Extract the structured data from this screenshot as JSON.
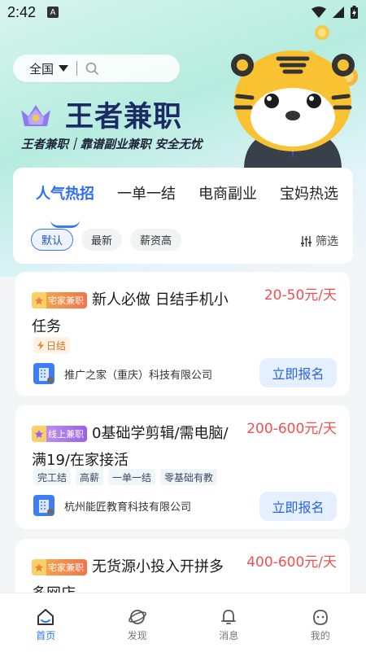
{
  "status_bar": {
    "time": "2:42",
    "badge": "A"
  },
  "search": {
    "city": "全国"
  },
  "app": {
    "title": "王者兼职",
    "slogan": "王者兼职｜靠谱副业兼职 安全无忧"
  },
  "tabs": [
    {
      "label": "人气热招",
      "active": true
    },
    {
      "label": "一单一结"
    },
    {
      "label": "电商副业"
    },
    {
      "label": "宝妈热选"
    }
  ],
  "sort_chips": [
    {
      "label": "默认",
      "active": true
    },
    {
      "label": "最新"
    },
    {
      "label": "薪资高"
    }
  ],
  "filter_label": "筛选",
  "jobs": [
    {
      "badge": "宅家兼职",
      "title": "新人必做 日结手机小任务",
      "salary": "20-50元/天",
      "tags": [
        "日结"
      ],
      "company": "推广之家（重庆）科技有限公司",
      "apply": "立即报名"
    },
    {
      "badge": "线上兼职",
      "title": "0基础学剪辑/需电脑/满19/在家接活",
      "salary": "200-600元/天",
      "tags": [
        "完工结",
        "高薪",
        "一单一结",
        "零基础有教"
      ],
      "company": "杭州能匠教育科技有限公司",
      "apply": "立即报名"
    },
    {
      "badge": "宅家兼职",
      "title": "无货源小投入开拼多多网店",
      "salary": "400-600元/天"
    }
  ],
  "bottom_nav": [
    {
      "label": "首页",
      "active": true,
      "icon": "home-icon"
    },
    {
      "label": "发现",
      "icon": "planet-icon"
    },
    {
      "label": "消息",
      "icon": "bell-icon"
    },
    {
      "label": "我的",
      "icon": "face-icon"
    }
  ],
  "colors": {
    "accent": "#2d6cf6",
    "salary": "#f05050",
    "title": "#1c2a64"
  }
}
